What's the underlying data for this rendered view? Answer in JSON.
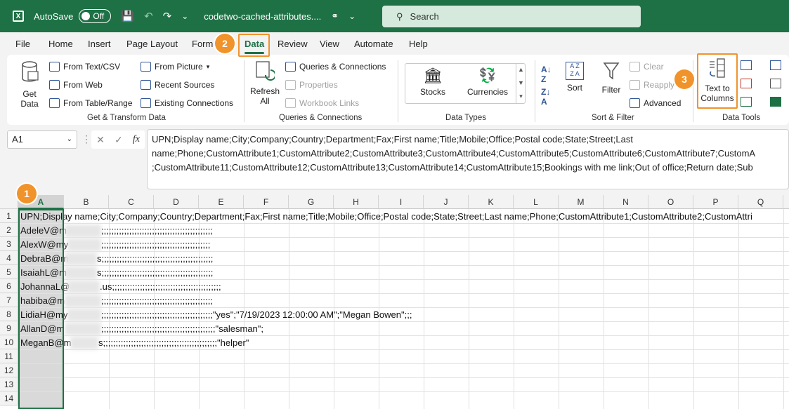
{
  "titlebar": {
    "autosave_label": "AutoSave",
    "autosave_state": "Off",
    "filename": "codetwo-cached-attributes....",
    "search_placeholder": "Search"
  },
  "menu": {
    "items": [
      "File",
      "Home",
      "Insert",
      "Page Layout",
      "Formu",
      "Data",
      "Review",
      "View",
      "Automate",
      "Help"
    ],
    "active": "Data"
  },
  "ribbon": {
    "get_data": {
      "line1": "Get",
      "line2": "Data"
    },
    "from_text_csv": "From Text/CSV",
    "from_web": "From Web",
    "from_table_range": "From Table/Range",
    "from_picture": "From Picture",
    "recent_sources": "Recent Sources",
    "existing_connections": "Existing Connections",
    "group_get_transform": "Get & Transform Data",
    "refresh_all": {
      "line1": "Refresh",
      "line2": "All"
    },
    "queries_connections": "Queries & Connections",
    "properties": "Properties",
    "workbook_links": "Workbook Links",
    "group_queries": "Queries & Connections",
    "stocks": "Stocks",
    "currencies": "Currencies",
    "group_data_types": "Data Types",
    "sort": "Sort",
    "filter": "Filter",
    "clear": "Clear",
    "reapply": "Reapply",
    "advanced": "Advanced",
    "group_sort_filter": "Sort & Filter",
    "text_to_columns": {
      "line1": "Text to",
      "line2": "Columns"
    },
    "group_data_tools": "Data Tools"
  },
  "formula_bar": {
    "namebox": "A1",
    "fx": "fx",
    "lines": [
      "UPN;Display name;City;Company;Country;Department;Fax;First name;Title;Mobile;Office;Postal code;State;Street;Last",
      "name;Phone;CustomAttribute1;CustomAttribute2;CustomAttribute3;CustomAttribute4;CustomAttribute5;CustomAttribute6;CustomAttribute7;CustomA",
      ";CustomAttribute11;CustomAttribute12;CustomAttribute13;CustomAttribute14;CustomAttribute15;Bookings with me link;Out of office;Return date;Sub"
    ]
  },
  "grid": {
    "columns": [
      "A",
      "B",
      "C",
      "D",
      "E",
      "F",
      "G",
      "H",
      "I",
      "J",
      "K",
      "L",
      "M",
      "N",
      "O",
      "P",
      "Q"
    ],
    "rows": [
      "1",
      "2",
      "3",
      "4",
      "5",
      "6",
      "7",
      "8",
      "9",
      "10",
      "11",
      "12",
      "13",
      "14"
    ],
    "cells": [
      "UPN;Display name;City;Company;Country;Department;Fax;First name;Title;Mobile;Office;Postal code;State;Street;Last name;Phone;CustomAttribute1;CustomAttribute2;CustomAttri",
      "AdeleV@m",
      "AlexW@my",
      "DebraB@m",
      "IsaiahL@m",
      "JohannaL@",
      "habiba@m",
      "LidiaH@my",
      "AllanD@m",
      "MeganB@m"
    ],
    "cells_tail": [
      "",
      ";;;;;;;;;;;;;;;;;;;;;;;;;;;;;;;;;;;;;;;;;;;;",
      ";;;;;;;;;;;;;;;;;;;;;;;;;;;;;;;;;;;;;;;;;;;",
      "s;;;;;;;;;;;;;;;;;;;;;;;;;;;;;;;;;;;;;;;;;;;;",
      "s;;;;;;;;;;;;;;;;;;;;;;;;;;;;;;;;;;;;;;;;;;;;",
      ".us;;;;;;;;;;;;;;;;;;;;;;;;;;;;;;;;;;;;;;;;;;;",
      ";;;;;;;;;;;;;;;;;;;;;;;;;;;;;;;;;;;;;;;;;;;;",
      ";;;;;;;;;;;;;;;;;;;;;;;;;;;;;;;;;;;;;;;;;;;;\"yes\";\"7/19/2023 12:00:00 AM\";\"Megan Bowen\";;;",
      ";;;;;;;;;;;;;;;;;;;;;;;;;;;;;;;;;;;;;;;;;;;;;\"salesman\";",
      "s;;;;;;;;;;;;;;;;;;;;;;;;;;;;;;;;;;;;;;;;;;;;;\"helper\""
    ]
  },
  "callouts": [
    "1",
    "2",
    "3"
  ],
  "colors": {
    "accent": "#1e7145",
    "callout": "#f0932b"
  }
}
